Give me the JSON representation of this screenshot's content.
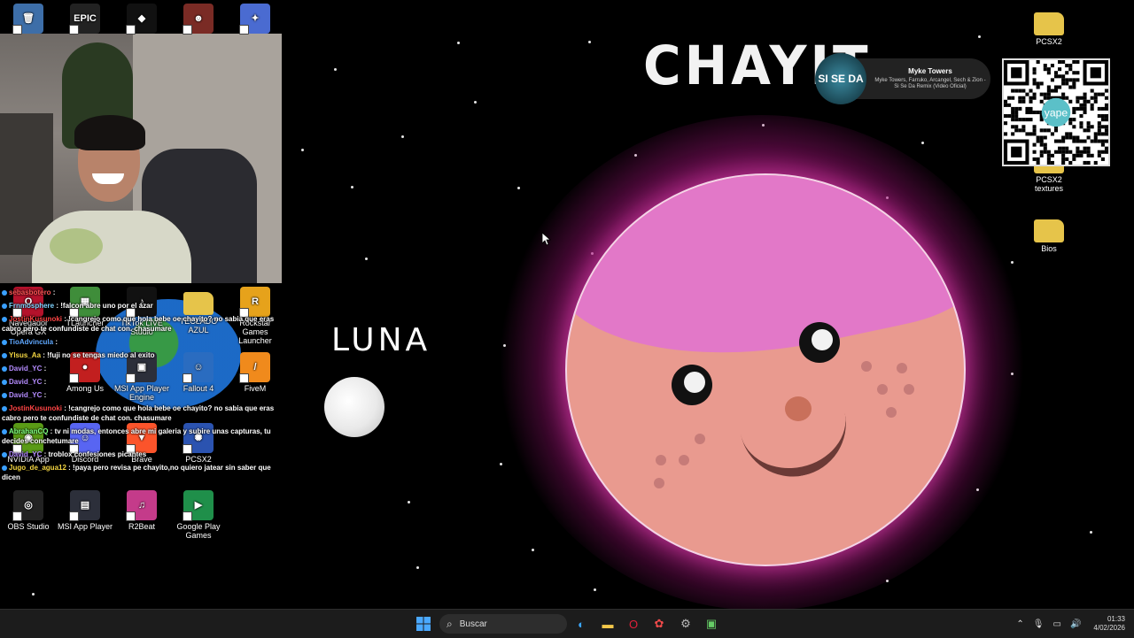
{
  "desktop_icons": [
    {
      "label": "",
      "name": "recycle-bin-icon",
      "glyph": "🗑",
      "color": "#3d6ea8"
    },
    {
      "label": "",
      "name": "epic-games-icon",
      "glyph": "EPIC",
      "color": "#222"
    },
    {
      "label": "",
      "name": "roblox-icon",
      "glyph": "◆",
      "color": "#111"
    },
    {
      "label": "",
      "name": "game-shortcut-icon",
      "glyph": "☻",
      "color": "#7a2b25"
    },
    {
      "label": "",
      "name": "game-shortcut-2-icon",
      "glyph": "✦",
      "color": "#4a6bd1"
    },
    {
      "label": "Navegador Opera GX",
      "name": "opera-gx-icon",
      "glyph": "O",
      "color": "#b3122b"
    },
    {
      "label": "TLauncher",
      "name": "tlauncher-icon",
      "glyph": "▦",
      "color": "#3f8d3a"
    },
    {
      "label": "TikTok LIVE Studio",
      "name": "tiktok-icon",
      "glyph": "♪",
      "color": "#111"
    },
    {
      "label": "TECLADO AZUL",
      "name": "folder-icon",
      "glyph": "",
      "color": "#e6c44a"
    },
    {
      "label": "Rockstar Games Launcher",
      "name": "rockstar-icon",
      "glyph": "R",
      "color": "#e6a21b"
    },
    {
      "label": "Among Us",
      "name": "among-us-icon",
      "glyph": "●",
      "color": "#c21f1f"
    },
    {
      "label": "MSI App Player Engine",
      "name": "msi-engine-icon",
      "glyph": "▣",
      "color": "#2c2f3a"
    },
    {
      "label": "Fallout 4",
      "name": "fallout-icon",
      "glyph": "☺",
      "color": "#2a6cc0"
    },
    {
      "label": "FiveM",
      "name": "fivem-icon",
      "glyph": "/",
      "color": "#f08a1c"
    },
    {
      "label": "NVIDIA App",
      "name": "nvidia-icon",
      "glyph": "◉",
      "color": "#5a9b16"
    },
    {
      "label": "Discord",
      "name": "discord-icon",
      "glyph": "☺",
      "color": "#5865f2"
    },
    {
      "label": "Brave",
      "name": "brave-icon",
      "glyph": "▼",
      "color": "#fb542b"
    },
    {
      "label": "PCSX2",
      "name": "pcsx2-icon",
      "glyph": "✺",
      "color": "#2b53b0"
    },
    {
      "label": "OBS Studio",
      "name": "obs-icon",
      "glyph": "◎",
      "color": "#222"
    },
    {
      "label": "MSI App Player",
      "name": "msi-player-icon",
      "glyph": "▤",
      "color": "#2c2f3a"
    },
    {
      "label": "R2Beat",
      "name": "r2beat-icon",
      "glyph": "♫",
      "color": "#c43b8a"
    },
    {
      "label": "Google Play Games",
      "name": "google-play-icon",
      "glyph": "▶",
      "color": "#1f8f4a"
    },
    {
      "label": "PCSX2",
      "name": "pcsx2-folder-icon",
      "glyph": "",
      "color": "#e6c44a"
    },
    {
      "label": "PCSX2 textures",
      "name": "pcsx2-textures-folder-icon",
      "glyph": "",
      "color": "#e6c44a"
    },
    {
      "label": "Bios",
      "name": "bios-folder-icon",
      "glyph": "",
      "color": "#e6c44a"
    }
  ],
  "chat": [
    {
      "user": "sebasbotero",
      "color": "#ff5555",
      "msg": ":"
    },
    {
      "user": "Frnmosphere",
      "color": "#7fd4ff",
      "msg": ": !falcon abre uno por el azar"
    },
    {
      "user": "JostinKusunoki",
      "color": "#ff4444",
      "msg": ": !cangrejo como que hola bebe oe chayito? no sabia que eras cabro pero te confundiste de chat con. chasumare"
    },
    {
      "user": "TioAdvincula",
      "color": "#5fa8ff",
      "msg": ":"
    },
    {
      "user": "Ylsus_Aa",
      "color": "#f5d742",
      "msg": ": !fuji no se tengas miedo al exito"
    },
    {
      "user": "David_YC",
      "color": "#b58cff",
      "msg": ":"
    },
    {
      "user": "David_YC",
      "color": "#b58cff",
      "msg": ":"
    },
    {
      "user": "David_YC",
      "color": "#b58cff",
      "msg": ":"
    },
    {
      "user": "JostinKusunoki",
      "color": "#ff4444",
      "msg": ": !cangrejo como que hola bebe oe chayito? no sabia que eras cabro pero te confundiste de chat con. chasumare"
    },
    {
      "user": "AbrahanCQ",
      "color": "#7fff7f",
      "msg": ": tv ni modas, entonces abre mi galeria y subire unas capturas, tu decides conchetumare"
    },
    {
      "user": "David_YC",
      "color": "#b58cff",
      "msg": ": troblox confesiones picantes"
    },
    {
      "user": "Jugo_de_agua12",
      "color": "#f5d742",
      "msg": ": !paya pero revisa pe chayito,no quiero jatear sin saber que dicen"
    }
  ],
  "drawing": {
    "title": "CHAYIT",
    "moon_label": "LUNA"
  },
  "now_playing": {
    "art_text": "SI SE DA",
    "artist": "Myke Towers",
    "song": "Myke Towers, Farruko, Arcangel, Sech & Zion - Si Se Da Remix (Video Oficial)"
  },
  "qr": {
    "brand": "yape"
  },
  "taskbar": {
    "search_placeholder": "Buscar",
    "time": "01:33",
    "date": "4/02/2026"
  }
}
